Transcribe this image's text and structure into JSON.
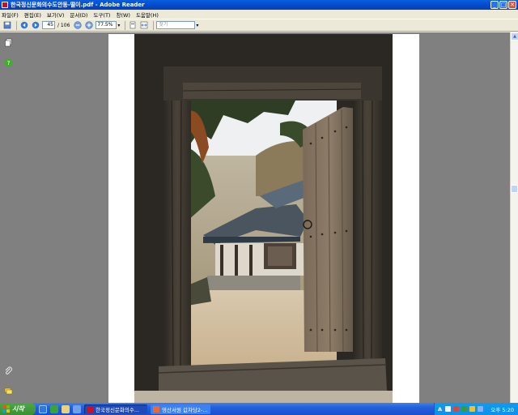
{
  "window": {
    "title": "한국정신문화의수도안동-떨이.pdf - Adobe Reader",
    "minimize_label": "_",
    "maximize_label": "□",
    "close_label": "✕"
  },
  "menu": {
    "items": [
      "파일(F)",
      "편집(E)",
      "보기(V)",
      "문서(D)",
      "도구(T)",
      "창(W)",
      "도움말(H)"
    ]
  },
  "toolbar": {
    "current_page": "45",
    "total_pages": "/ 106",
    "zoom": "77.5%",
    "search_placeholder": "찾기"
  },
  "taskbar": {
    "start_label": "시작",
    "tasks": [
      {
        "label": "한국정신문화의수...",
        "active": true
      },
      {
        "label": "영산서원 값차당2-...",
        "active": false
      }
    ],
    "tray_lang": "A",
    "clock": "오후 5:20"
  },
  "colors": {
    "viewer_bg": "#808080",
    "titlebar": "#0348c8",
    "taskbar": "#245edb",
    "start": "#3c8f33"
  },
  "icons": [
    "pages-icon",
    "help-icon",
    "attachment-icon",
    "comments-icon",
    "save-icon",
    "print-icon"
  ]
}
